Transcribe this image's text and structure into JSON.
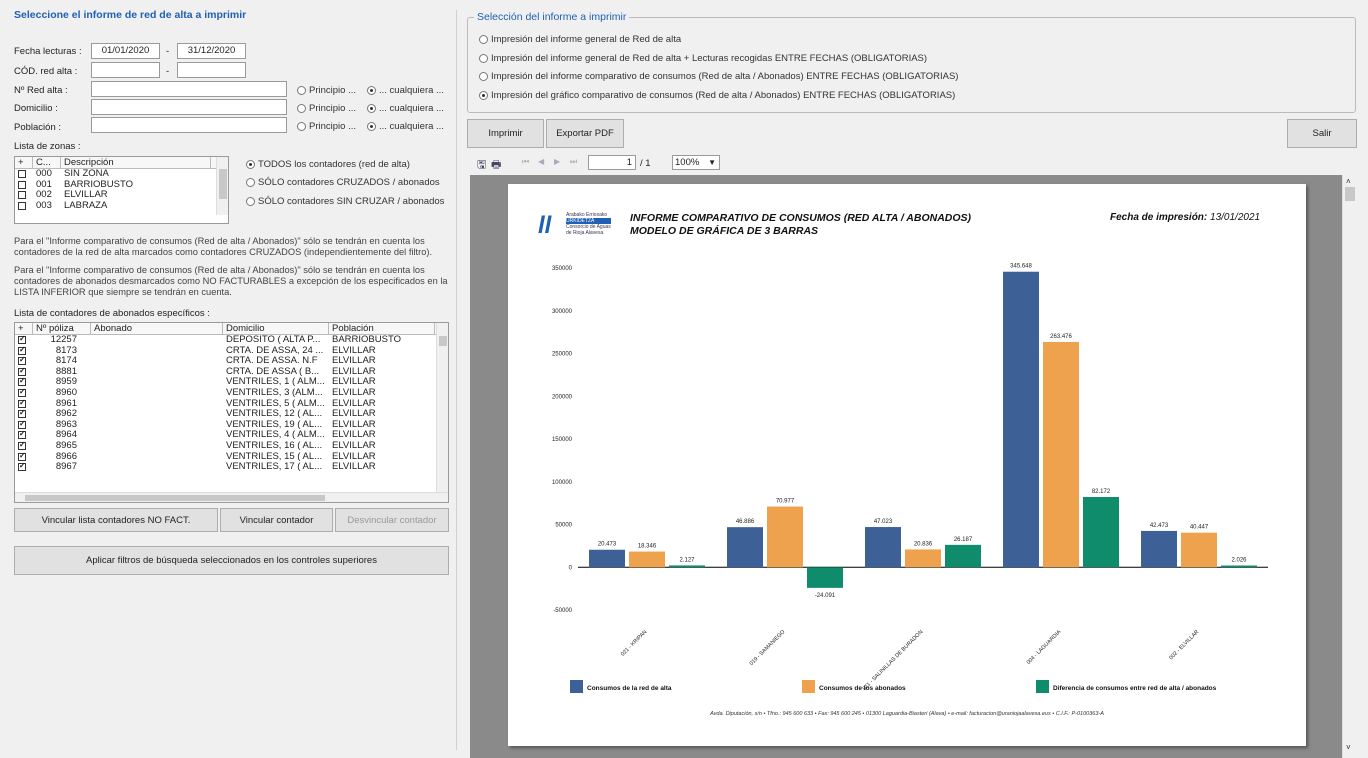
{
  "left": {
    "heading": "Seleccione el informe de red de alta a imprimir",
    "fecha_label": "Fecha lecturas :",
    "fecha_from": "01/01/2020",
    "fecha_to": "31/12/2020",
    "dash": "-",
    "cod_label": "CÓD. red alta :",
    "nred_label": "Nº Red alta :",
    "domicilio_label": "Domicilio :",
    "poblacion_label": "Población :",
    "principio": "Principio ...",
    "cualquiera": "... cualquiera ...",
    "zonas_label": "Lista de zonas :",
    "zonas_headers": [
      "+",
      "C...",
      "Descripción"
    ],
    "zonas": [
      {
        "code": "000",
        "desc": "SIN ZONA"
      },
      {
        "code": "001",
        "desc": "BARRIOBUSTO"
      },
      {
        "code": "002",
        "desc": "ELVILLAR"
      },
      {
        "code": "003",
        "desc": "LABRAZA"
      }
    ],
    "contadores_opts": [
      "TODOS los contadores (red de alta)",
      "SÓLO contadores CRUZADOS / abonados",
      "SÓLO contadores SIN CRUZAR / abonados"
    ],
    "note1": "Para el \"Informe comparativo de consumos (Red de alta / Abonados)\" sólo se tendrán en cuenta los contadores de la red de alta marcados como contadores CRUZADOS (independientemente del filtro).",
    "note2": "Para el \"Informe comparativo de consumos (Red de alta / Abonados)\" sólo se tendrán en cuenta los contadores de abonados desmarcados como NO FACTURABLES a excepción de los especificados en la LISTA INFERIOR que siempre se tendrán en cuenta.",
    "abonados_label": "Lista de contadores de abonados específicos :",
    "abonados_headers": [
      "+",
      "Nº póliza",
      "Abonado",
      "Domicilio",
      "Población"
    ],
    "abonados": [
      {
        "poliza": "12257",
        "abonado": "",
        "domicilio": "DEPOSITO ( ALTA P...",
        "poblacion": "BARRIOBUSTO"
      },
      {
        "poliza": "8173",
        "abonado": "",
        "domicilio": "CRTA. DE ASSA, 24 ...",
        "poblacion": "ELVILLAR"
      },
      {
        "poliza": "8174",
        "abonado": "",
        "domicilio": "CRTA. DE ASSA. N.F",
        "poblacion": "ELVILLAR"
      },
      {
        "poliza": "8881",
        "abonado": "",
        "domicilio": "CRTA. DE ASSA ( B...",
        "poblacion": "ELVILLAR"
      },
      {
        "poliza": "8959",
        "abonado": "",
        "domicilio": "VENTRILES, 1 ( ALM...",
        "poblacion": "ELVILLAR"
      },
      {
        "poliza": "8960",
        "abonado": "",
        "domicilio": "VENTRILES, 3 (ALM...",
        "poblacion": "ELVILLAR"
      },
      {
        "poliza": "8961",
        "abonado": "",
        "domicilio": "VENTRILES, 5 ( ALM...",
        "poblacion": "ELVILLAR"
      },
      {
        "poliza": "8962",
        "abonado": "",
        "domicilio": "VENTRILES, 12 ( AL...",
        "poblacion": "ELVILLAR"
      },
      {
        "poliza": "8963",
        "abonado": "",
        "domicilio": "VENTRILES, 19 ( AL...",
        "poblacion": "ELVILLAR"
      },
      {
        "poliza": "8964",
        "abonado": "",
        "domicilio": "VENTRILES, 4 ( ALM...",
        "poblacion": "ELVILLAR"
      },
      {
        "poliza": "8965",
        "abonado": "",
        "domicilio": "VENTRILES, 16 ( AL...",
        "poblacion": "ELVILLAR"
      },
      {
        "poliza": "8966",
        "abonado": "",
        "domicilio": "VENTRILES, 15 ( AL...",
        "poblacion": "ELVILLAR"
      },
      {
        "poliza": "8967",
        "abonado": "",
        "domicilio": "VENTRILES, 17 ( AL...",
        "poblacion": "ELVILLAR"
      }
    ],
    "btn_vincular_lista": "Vincular lista contadores NO FACT.",
    "btn_vincular": "Vincular contador",
    "btn_desvincular": "Desvincular contador",
    "btn_aplicar": "Aplicar filtros de búsqueda seleccionados en los controles superiores"
  },
  "right": {
    "legend": "Selección del informe a imprimir",
    "options": [
      "Impresión del informe general de Red de alta",
      "Impresión del informe general de Red de alta + Lecturas recogidas ENTRE FECHAS (OBLIGATORIAS)",
      "Impresión del informe comparativo de consumos (Red de alta / Abonados) ENTRE FECHAS (OBLIGATORIAS)",
      "Impresión del gráfico comparativo de consumos (Red de alta / Abonados) ENTRE FECHAS (OBLIGATORIAS)"
    ],
    "selected_option": 3,
    "btn_imprimir": "Imprimir",
    "btn_exportar": "Exportar PDF",
    "btn_salir": "Salir",
    "viewer": {
      "page": "1",
      "of": "/ 1",
      "zoom": "100%"
    }
  },
  "report": {
    "logo_text": [
      "Arabako Errioxako",
      "URKIDETZA",
      "Consorcio de Aguas",
      "de Rioja Alavesa"
    ],
    "title1": "INFORME COMPARATIVO DE CONSUMOS (RED ALTA / ABONADOS)",
    "title2": "MODELO DE GRÁFICA DE 3 BARRAS",
    "fecha_label": "Fecha de impresión:",
    "fecha_value": "13/01/2021",
    "footer": "Avda. Diputación, s/n • Tfno.: 945 600 633 • Fax: 945 600 245 • 01300 Laguardia-Biasteri (Alava) • e-mail: facturacion@uraniojaalavesa.eus • C.I.F.: P-0100363-A"
  },
  "chart_data": {
    "type": "bar",
    "categories": [
      "021 - KRIPAN",
      "019 - SAMANIEGO",
      "011 - SALINILLAS DE BURADON",
      "004 - LAGUARDIA",
      "002 - ELVILLAR"
    ],
    "series": [
      {
        "name": "Consumos de la red de alta",
        "values": [
          20473,
          46886,
          47023,
          345648,
          42473
        ],
        "labels": [
          "20.473",
          "46.886",
          "47.023",
          "345.648",
          "42.473"
        ],
        "color": "#3d6096"
      },
      {
        "name": "Consumos de los abonados",
        "values": [
          18346,
          70977,
          20836,
          263476,
          40447
        ],
        "labels": [
          "18.346",
          "70.977",
          "20.836",
          "263.476",
          "40.447"
        ],
        "color": "#efa24d"
      },
      {
        "name": "Diferencia de consumos entre red de alta / abonados",
        "values": [
          2127,
          -24091,
          26187,
          82172,
          2026
        ],
        "labels": [
          "2.127",
          "-24.091",
          "26.187",
          "82.172",
          "2.026"
        ],
        "color": "#0e8c6c"
      }
    ],
    "yticks": [
      350000,
      300000,
      250000,
      200000,
      150000,
      100000,
      50000,
      0,
      -50000
    ],
    "ylim": [
      -50000,
      350000
    ],
    "legend": "bottom"
  }
}
